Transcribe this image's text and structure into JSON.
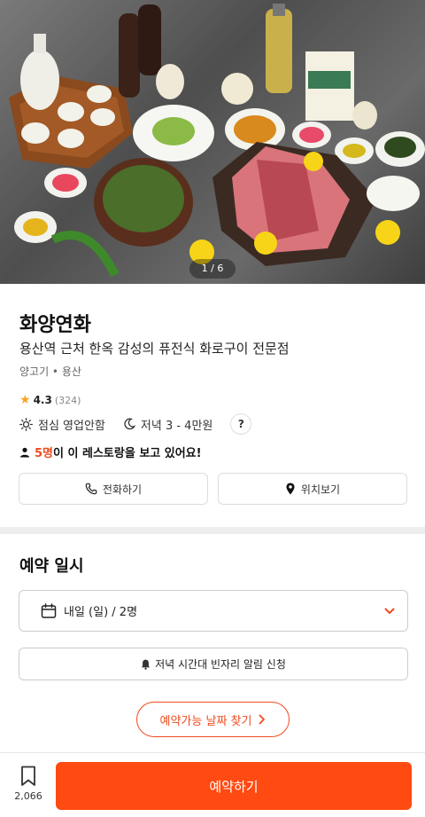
{
  "hero": {
    "pager": "1 / 6"
  },
  "restaurant": {
    "name": "화양연화",
    "subtitle": "용산역 근처 한옥 감성의 퓨전식 화로구이 전문점",
    "category": "양고기 • 용산",
    "rating": "4.3",
    "rating_count": "(324)",
    "lunch": "점심 영업안함",
    "dinner": "저녁 3 - 4만원",
    "help": "?",
    "viewing_count": "5명",
    "viewing_text": "이 이 레스토랑을 보고 있어요!"
  },
  "actions": {
    "call": "전화하기",
    "location": "위치보기"
  },
  "reservation": {
    "section_title": "예약 일시",
    "date_value": "내일 (일) / 2명",
    "alert": "저녁 시간대 빈자리 알림 신청",
    "find_dates": "예약가능 날짜 찾기"
  },
  "bottom": {
    "bookmark_count": "2,066",
    "reserve": "예약하기"
  },
  "colors": {
    "accent": "#ff4a12",
    "accent_text": "#ef4b1e",
    "star": "#f5a623"
  }
}
